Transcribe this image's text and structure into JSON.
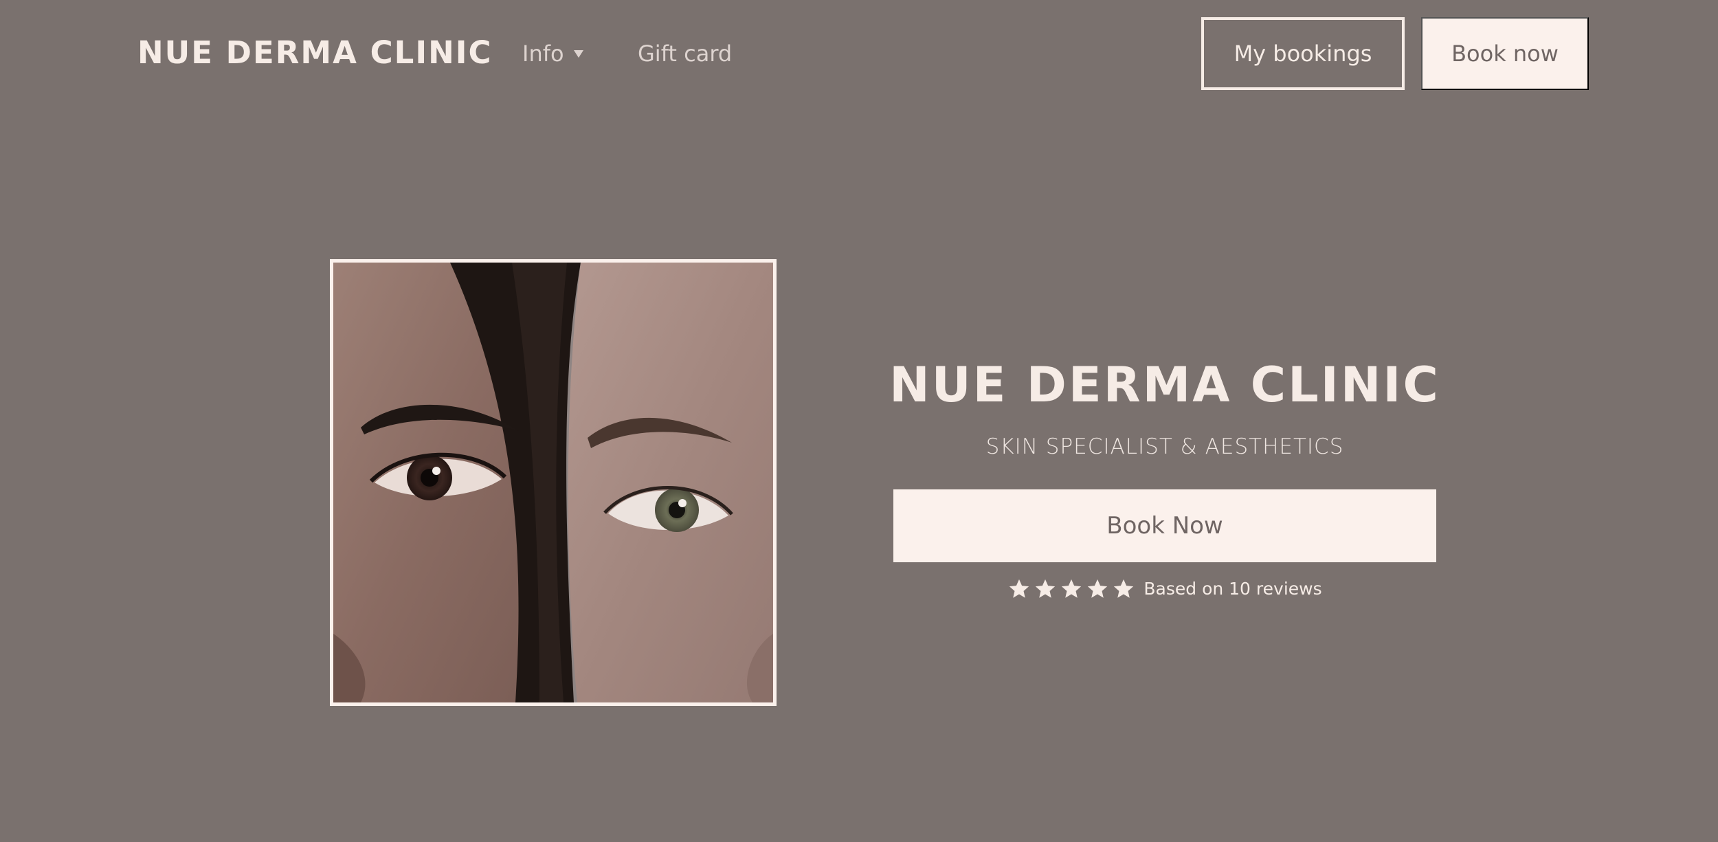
{
  "header": {
    "logo": "NUE DERMA CLINIC",
    "nav": {
      "info_label": "Info",
      "gift_card_label": "Gift card"
    },
    "my_bookings_label": "My bookings",
    "book_now_label": "Book now"
  },
  "hero": {
    "title": "NUE DERMA CLINIC",
    "subtitle": "SKIN SPECIALIST & AESTHETICS",
    "cta_label": "Book Now",
    "rating": {
      "stars": 5,
      "text": "Based on 10 reviews"
    }
  },
  "colors": {
    "background": "#7a716e",
    "cream": "#fbf1ec",
    "text_light": "#f6ece6",
    "button_text": "#6f6563"
  },
  "icons": {
    "caret": "chevron-down-icon",
    "star": "star-icon"
  }
}
